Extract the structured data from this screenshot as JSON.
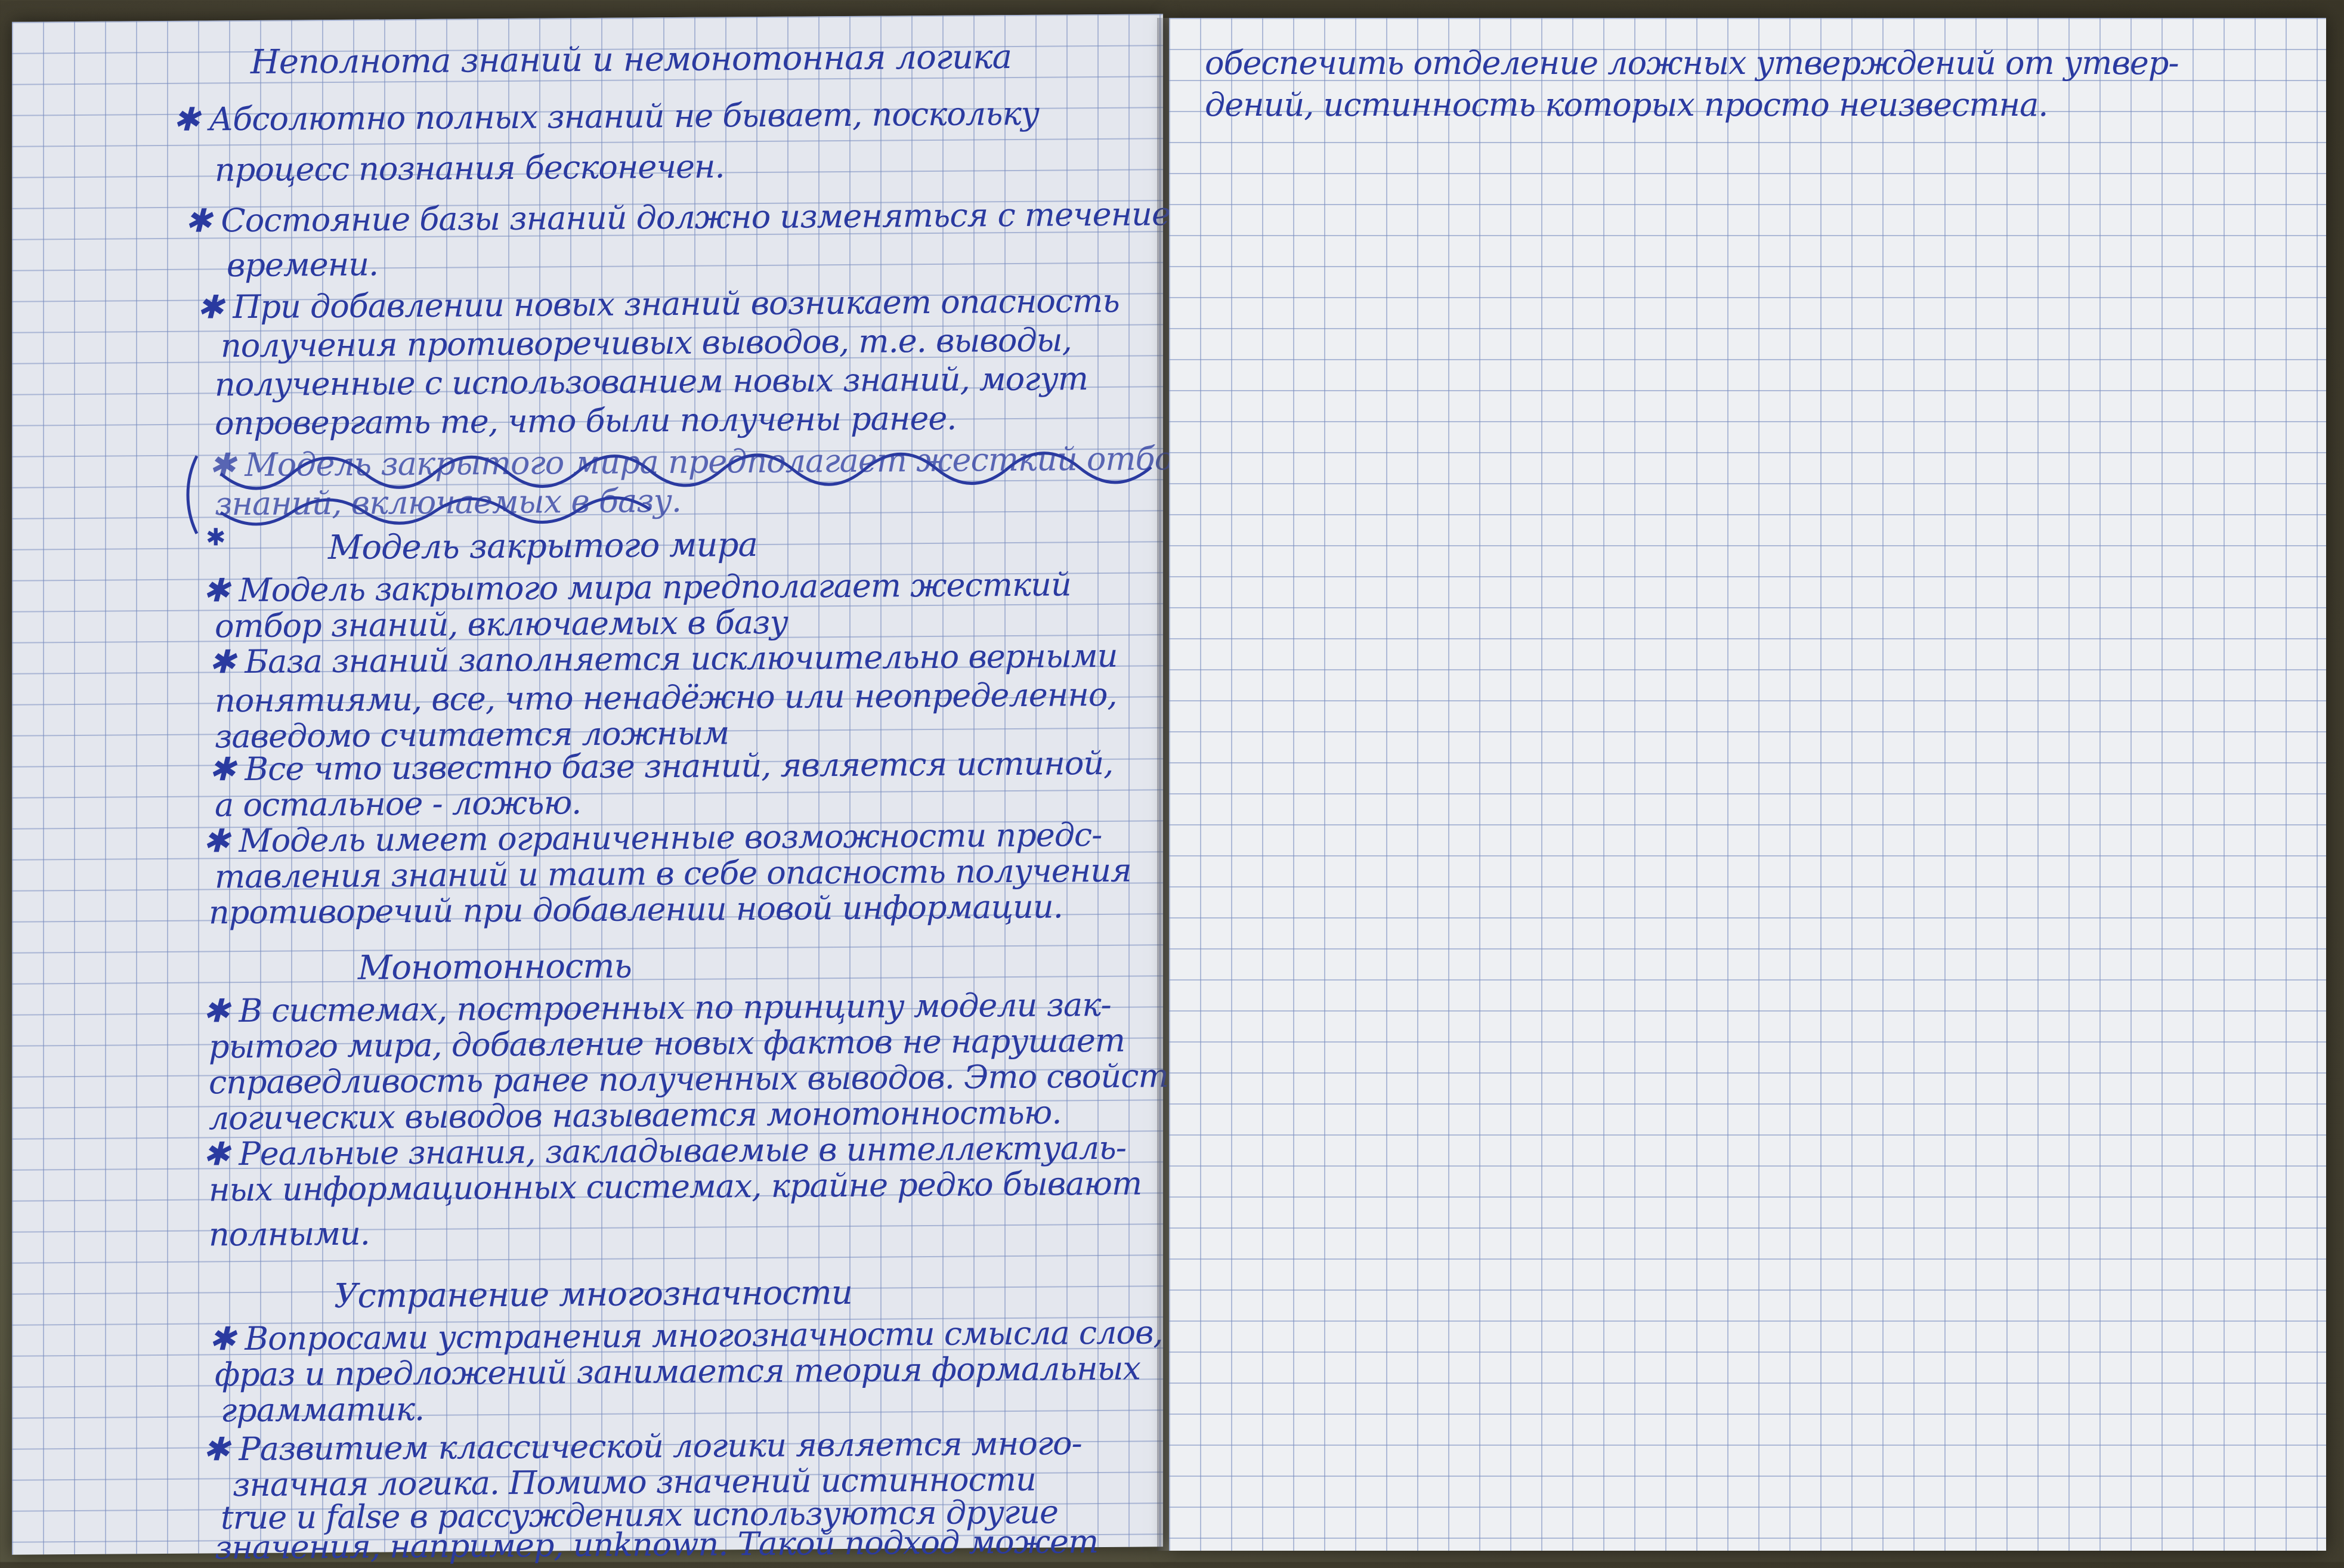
{
  "left_page": {
    "section1": {
      "heading": "Неполнота знаний и немонотонная логика",
      "lines": [
        "✱ Абсолютно полных знаний не бывает, поскольку",
        "процесс познания бесконечен.",
        "✱ Состояние базы знаний должно изменяться с течением",
        "времени.",
        "✱ При добавлении новых знаний возникает опасность",
        "получения противоречивых выводов, т.е. выводы,",
        "полученные с использованием новых знаний, могут",
        "опровергать те, что были получены ранее.",
        "✱ Модель закрытого мира предполагает жесткий отбор-",
        "знаний, включаемых в базу."
      ]
    },
    "section2": {
      "heading": "Модель закрытого мира",
      "lines": [
        "✱ Модель закрытого мира предполагает жесткий",
        "отбор знаний, включаемых в базу",
        "✱ База знаний заполняется исключительно верными",
        "понятиями, все, что ненадёжно или неопределенно,",
        "заведомо считается ложным",
        "✱ Все что известно базе знаний, является истиной,",
        "а остальное - ложью.",
        "✱ Модель имеет ограниченные возможности предс-",
        "тавления знаний и таит в себе опасность получения",
        "противоречий при добавлении новой информации."
      ]
    },
    "section3": {
      "heading": "Монотонность",
      "lines": [
        "✱ В системах, построенных по принципу модели зак-",
        "рытого мира, добавление новых фактов не нарушает",
        "справедливость ранее полученных выводов. Это свойство",
        "логических выводов называется монотонностью.",
        "✱ Реальные знания, закладываемые в интеллектуаль-",
        "ных информационных системах, крайне редко бывают",
        "полными."
      ]
    },
    "section4": {
      "heading": "Устранение многозначности",
      "lines": [
        "✱ Вопросами устранения многозначности смысла слов,",
        "фраз и предложений занимается теория формальных",
        "грамматик.",
        "✱ Развитием классической логики является много-",
        "значная логика. Помимо значений истинности",
        "true и false в рассуждениях используются другие",
        "значения, например, unknown. Такой подход может"
      ]
    }
  },
  "right_page": {
    "lines": [
      "обеспечить отделение ложных утверждений от утвер-",
      "дений, истинность которых просто неизвестна."
    ]
  },
  "colors": {
    "ink": "#2a3aa0",
    "grid": "#788cbe",
    "paper": "#e9ecf1"
  }
}
